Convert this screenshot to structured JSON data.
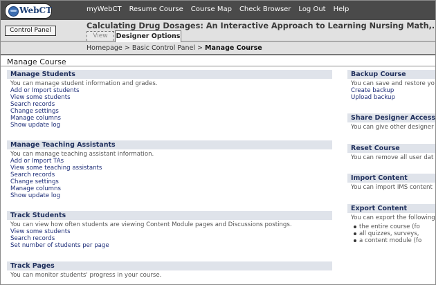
{
  "app": {
    "logo_text": "WebCT"
  },
  "nav": {
    "items": [
      "myWebCT",
      "Resume Course",
      "Course Map",
      "Check Browser",
      "Log Out",
      "Help"
    ]
  },
  "header": {
    "control_panel_label": "Control Panel",
    "course_title": "Calculating Drug Dosages: An Interactive Approach to Learning Nursing Math,...",
    "tabs": [
      "View",
      "Designer Options"
    ],
    "breadcrumb": [
      "Homepage",
      "Basic Control Panel",
      "Manage Course"
    ],
    "breadcrumb_sep": ">"
  },
  "page": {
    "title": "Manage Course"
  },
  "left_sections": [
    {
      "heading": "Manage Students",
      "description": "You can manage student information and grades.",
      "links": [
        "Add or Import students",
        "View some students",
        "Search records",
        "Change settings",
        "Manage columns",
        "Show update log"
      ]
    },
    {
      "heading": "Manage Teaching Assistants",
      "description": "You can manage teaching assistant information.",
      "links": [
        "Add or Import TAs",
        "View some teaching assistants",
        "Search records",
        "Change settings",
        "Manage columns",
        "Show update log"
      ]
    },
    {
      "heading": "Track Students",
      "description": "You can view how often students are viewing Content Module pages and Discussions postings.",
      "links": [
        "View some students",
        "Search records",
        "Set number of students per page"
      ]
    },
    {
      "heading": "Track Pages",
      "description": "You can monitor students' progress in your course.",
      "links": []
    }
  ],
  "right_sections": [
    {
      "heading": "Backup Course",
      "description": "You can save and restore yo",
      "links": [
        "Create backup",
        "Upload backup"
      ]
    },
    {
      "heading": "Share Designer Access",
      "description": "You can give other designer",
      "links": []
    },
    {
      "heading": "Reset Course",
      "description": "You can remove all user dat",
      "links": []
    },
    {
      "heading": "Import Content",
      "description": "You can import IMS content",
      "links": []
    },
    {
      "heading": "Export Content",
      "description": "You can export the following",
      "links": [],
      "bullets": [
        "the entire course (fo",
        "all quizzes, surveys,",
        "a content module (fo"
      ]
    }
  ]
}
